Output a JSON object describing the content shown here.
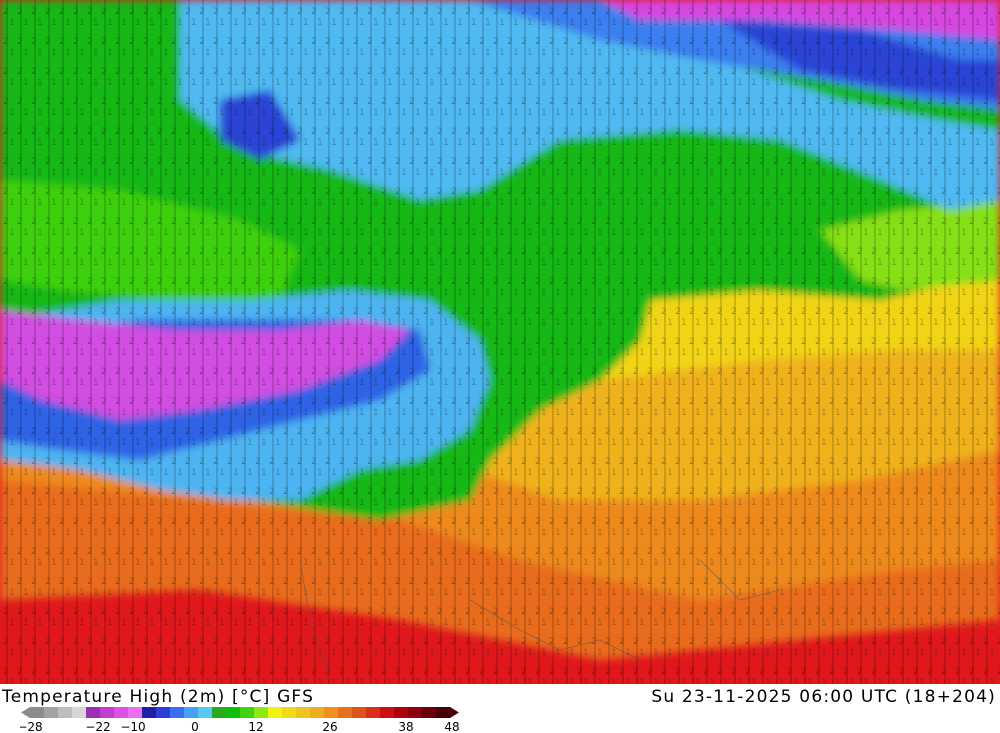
{
  "map": {
    "product": "Temperature High (2m) [°C]",
    "model": "GFS",
    "valid_time": "Su 23-11-2025 06:00 UTC (18+204)"
  },
  "legend": {
    "tick_labels": [
      "-28",
      "-22",
      "-10",
      "0",
      "12",
      "26",
      "38",
      "48"
    ],
    "colors": [
      "#8c8c8c",
      "#a3a3a3",
      "#bdbdbd",
      "#d6d6d6",
      "#9a2fb3",
      "#c23ccf",
      "#e04fe3",
      "#f06df5",
      "#1f1fa8",
      "#2a3fd6",
      "#3a6ff0",
      "#4a9ff6",
      "#55c8f5",
      "#2aa81e",
      "#0cc00c",
      "#3fd40f",
      "#8ee812",
      "#f2f210",
      "#f2da18",
      "#f0c21c",
      "#efac1f",
      "#f08f1c",
      "#e8721c",
      "#e05318",
      "#d8301a",
      "#cc0f12",
      "#b00010",
      "#8d000f",
      "#6b000c",
      "#4a0008"
    ]
  }
}
